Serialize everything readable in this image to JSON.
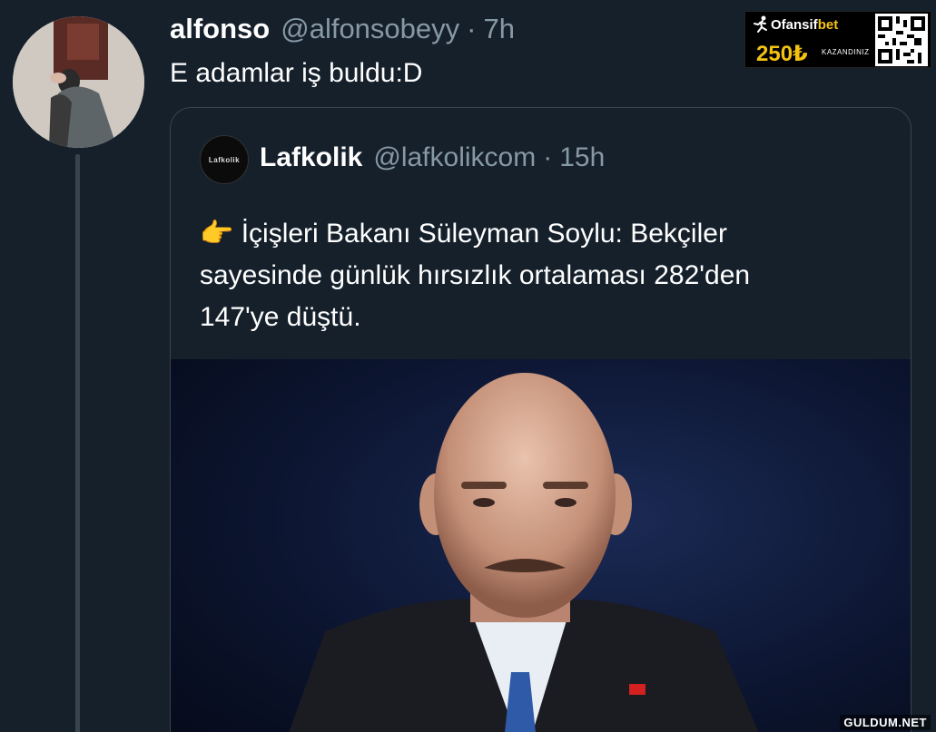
{
  "tweet": {
    "display_name": "alfonso",
    "handle": "@alfonsobeyy",
    "separator": "·",
    "timestamp": "7h",
    "text": "E adamlar iş buldu:D"
  },
  "quoted_tweet": {
    "avatar_text": "Lafkolik",
    "display_name": "Lafkolik",
    "handle": "@lafkolikcom",
    "separator": "·",
    "timestamp": "15h",
    "emoji": "👉",
    "text_lines": [
      "İçişleri Bakanı Süleyman Soylu: Bekçiler",
      "sayesinde günlük hırsızlık ortalaması 282'den",
      "147'ye düştü."
    ]
  },
  "ad": {
    "brand_plain": "Ofansif",
    "brand_accent": "bet",
    "amount": "250₺",
    "subtext": "KAZANDINIZ"
  },
  "watermark": "GULDUM.NET",
  "icons": {
    "avatar": "user-avatar-photo",
    "quoted_avatar": "lafkolik-logo",
    "runner": "runner-icon",
    "qr": "qr-code"
  },
  "colors": {
    "background": "#15202b",
    "border": "#38444d",
    "secondary_text": "#8899a6",
    "ad_accent": "#f5c211"
  }
}
